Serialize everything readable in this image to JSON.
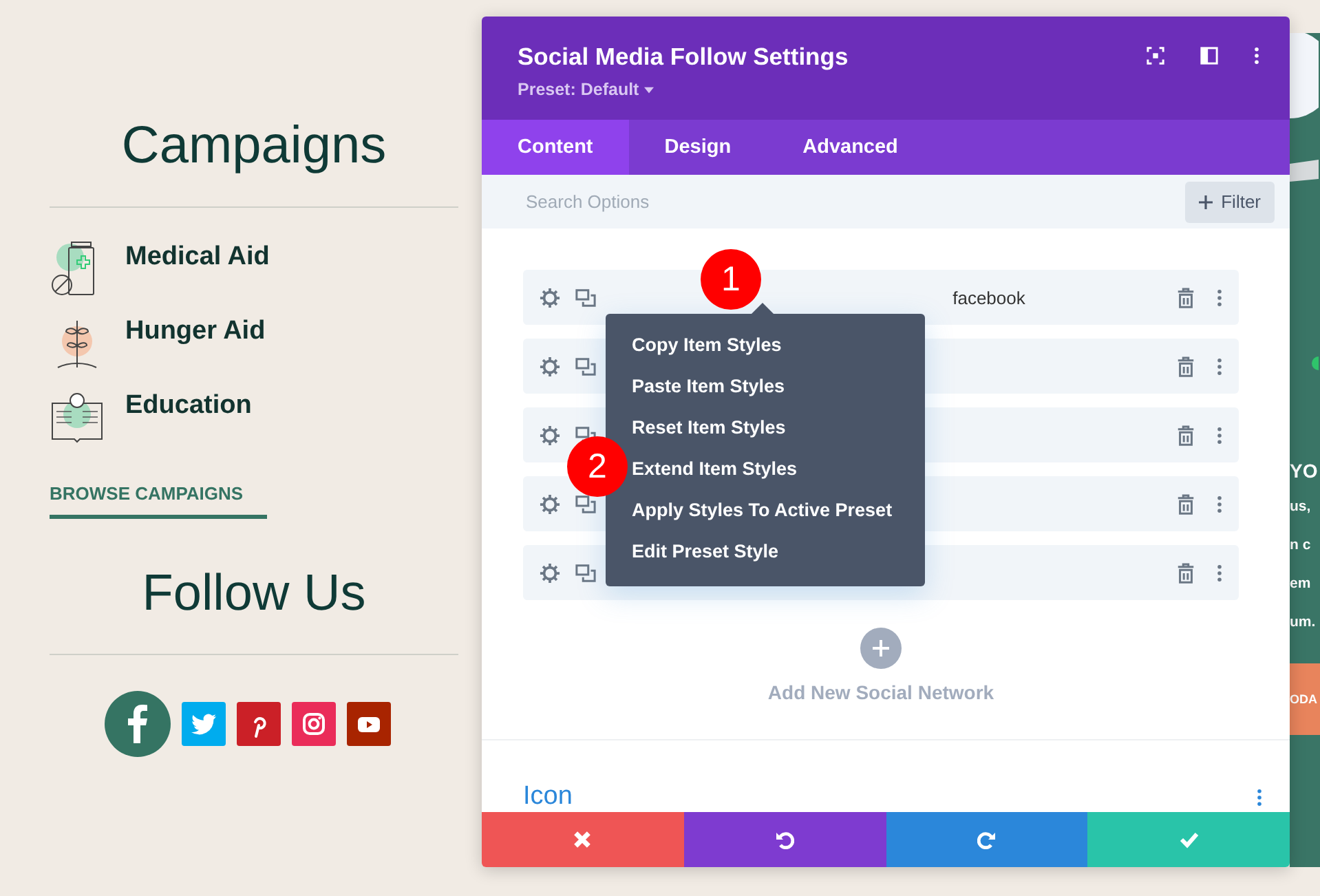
{
  "sidebar": {
    "campaigns_title": "Campaigns",
    "campaigns": [
      {
        "kind": "medical",
        "label": "Medical Aid"
      },
      {
        "kind": "hunger",
        "label": "Hunger Aid"
      },
      {
        "kind": "education",
        "label": "Education"
      }
    ],
    "browse_link": "BROWSE CAMPAIGNS",
    "follow_title": "Follow Us",
    "social_icons": [
      {
        "kind": "facebook",
        "color": "#357463"
      },
      {
        "kind": "twitter",
        "color": "#00acee"
      },
      {
        "kind": "pinterest",
        "color": "#cb2027"
      },
      {
        "kind": "instagram",
        "color": "#ea2c59"
      },
      {
        "kind": "youtube",
        "color": "#a82400"
      }
    ]
  },
  "modal": {
    "title": "Social Media Follow Settings",
    "preset": "Preset: Default",
    "tabs": [
      {
        "label": "Content",
        "selected": true
      },
      {
        "label": "Design",
        "selected": false
      },
      {
        "label": "Advanced",
        "selected": false
      }
    ],
    "search": {
      "placeholder": "Search Options"
    },
    "filter_button": "Filter",
    "networks": [
      {
        "kind": "labeled",
        "label": "facebook"
      },
      {
        "kind": "covered"
      },
      {
        "kind": "covered"
      },
      {
        "kind": "covered"
      },
      {
        "kind": "covered"
      }
    ],
    "context_menu": [
      "Copy Item Styles",
      "Paste Item Styles",
      "Reset Item Styles",
      "Extend Item Styles",
      "Apply Styles To Active Preset",
      "Edit Preset Style"
    ],
    "callouts": [
      "1",
      "2"
    ],
    "add_button": "Add New Social Network",
    "section_title": "Icon",
    "footer_buttons": [
      {
        "kind": "cancel",
        "color": "#ef5555"
      },
      {
        "kind": "undo",
        "color": "#7e3bd0"
      },
      {
        "kind": "redo",
        "color": "#2b87da"
      },
      {
        "kind": "save",
        "color": "#29c4a9"
      }
    ]
  },
  "background_page": {
    "heading": "YO",
    "lines": [
      "us,",
      "n c",
      "em",
      "um."
    ],
    "button": "ODA"
  }
}
